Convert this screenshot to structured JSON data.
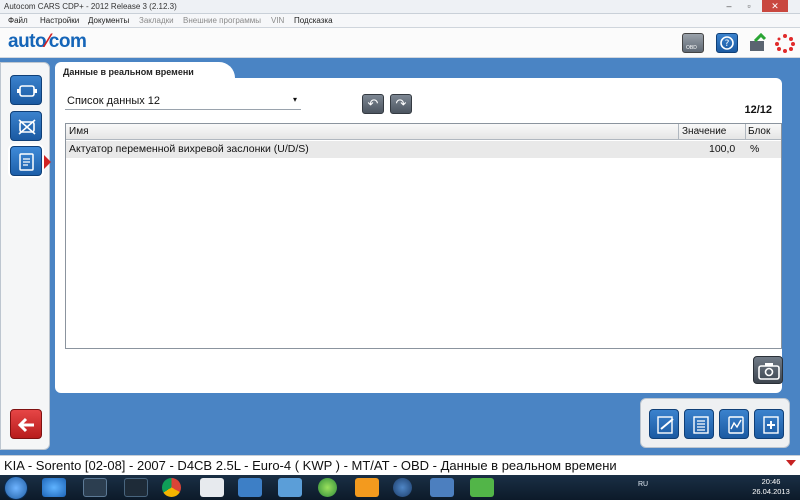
{
  "window": {
    "title": "Autocom CARS CDP+ - 2012 Release 3 (2.12.3)",
    "controls": {
      "minimize": "–",
      "maximize": "▫",
      "close": "✕"
    }
  },
  "menu": {
    "items": [
      "Файл",
      "Настройки",
      "Документы",
      "Закладки",
      "Внешние программы",
      "VIN",
      "Подсказка"
    ],
    "disabled": [
      false,
      false,
      false,
      true,
      true,
      true,
      false
    ]
  },
  "header": {
    "logo_left": "auto",
    "logo_mid": "⁄",
    "logo_right": "com",
    "obd_label": "OBD"
  },
  "tab": {
    "label": "Данные в реальном времени"
  },
  "datalist": {
    "selected": "Список данных 12",
    "caret": "▾",
    "counter": "12/12"
  },
  "nav": {
    "prev": "↶",
    "next": "↷"
  },
  "table": {
    "columns": [
      "Имя",
      "Значение",
      "Блок"
    ],
    "rows": [
      {
        "name": "Актуатор переменной вихревой заслонки (U/D/S)",
        "value": "100,0",
        "unit": "%"
      }
    ]
  },
  "status": {
    "text": "KIA - Sorento [02-08] - 2007 - D4CB 2.5L - Euro-4 ( KWP ) - MT/AT - OBD - Данные в реальном времени"
  },
  "taskbar": {
    "lang": "RU",
    "time": "20:46",
    "date": "26.04.2013"
  },
  "colors": {
    "accent": "#1b5aa2",
    "brand_red": "#d32222",
    "desktop_blue": "#4a84c4"
  }
}
